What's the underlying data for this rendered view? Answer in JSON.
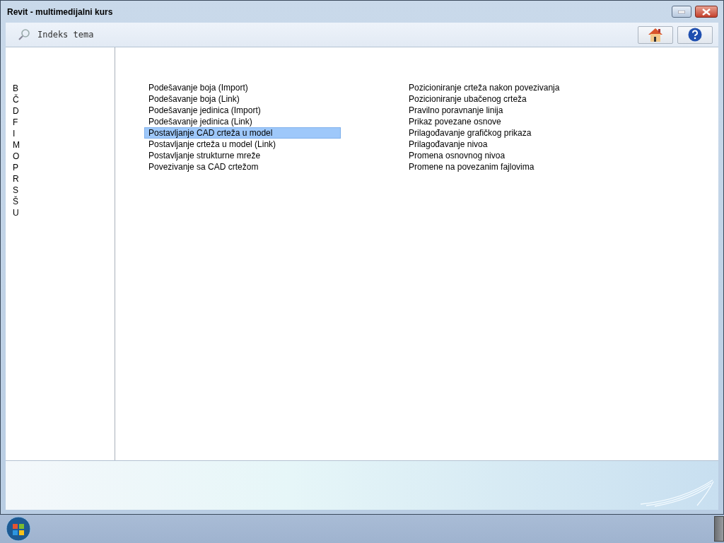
{
  "window": {
    "title": "Revit - multimedijalni kurs"
  },
  "toolbar": {
    "title": "Indeks tema"
  },
  "letters": [
    "B",
    "Č",
    "D",
    "F",
    "I",
    "M",
    "O",
    "P",
    "R",
    "S",
    "Š",
    "U"
  ],
  "topics": [
    {
      "label": "Podešavanje boja (Import)",
      "selected": false
    },
    {
      "label": "Podešavanje boja (Link)",
      "selected": false
    },
    {
      "label": "Podešavanje jedinica (Import)",
      "selected": false
    },
    {
      "label": "Podešavanje jedinica (Link)",
      "selected": false
    },
    {
      "label": "Postavljanje CAD crteža u model",
      "selected": true
    },
    {
      "label": "Postavljanje crteža u model (Link)",
      "selected": false
    },
    {
      "label": "Postavljanje strukturne mreže",
      "selected": false
    },
    {
      "label": "Povezivanje sa CAD crtežom",
      "selected": false
    },
    {
      "label": "Pozicioniranje crteža nakon povezivanja",
      "selected": false
    },
    {
      "label": "Pozicioniranje ubačenog crteža",
      "selected": false
    },
    {
      "label": "Pravilno poravnanje linija",
      "selected": false
    },
    {
      "label": "Prikaz povezane osnove",
      "selected": false
    },
    {
      "label": "Prilagođavanje grafičkog prikaza",
      "selected": false
    },
    {
      "label": "Prilagođavanje nivoa",
      "selected": false
    },
    {
      "label": "Promena osnovnog nivoa",
      "selected": false
    },
    {
      "label": "Promene na povezanim fajlovima",
      "selected": false
    }
  ]
}
